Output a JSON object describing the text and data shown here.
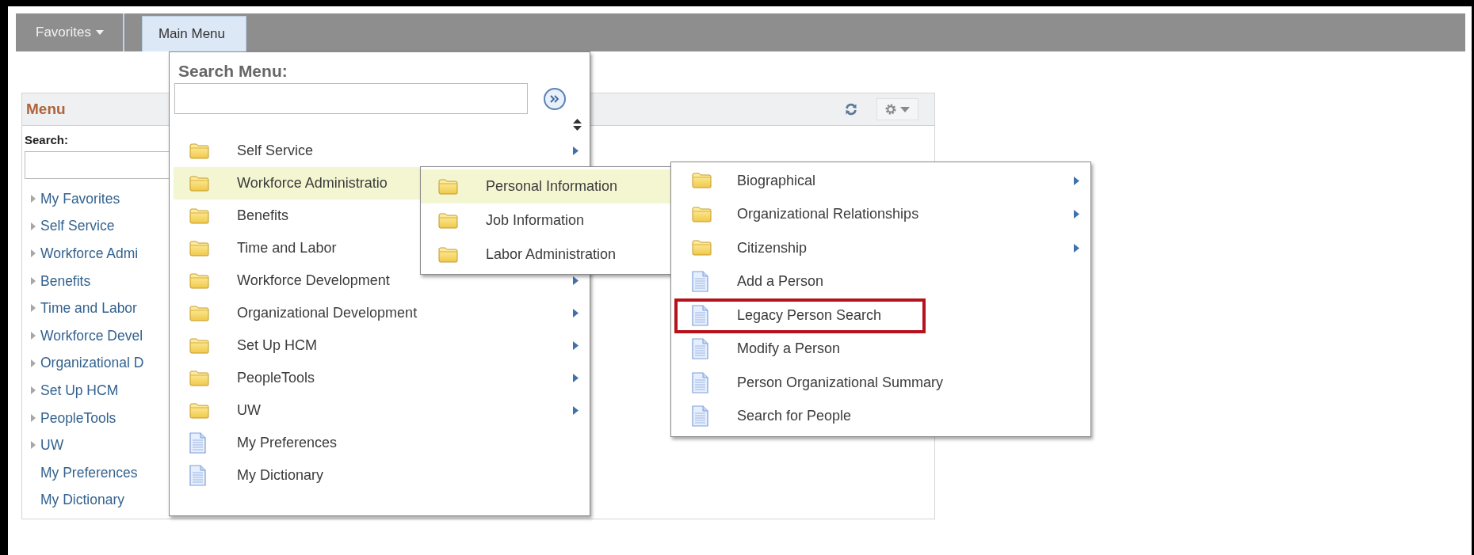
{
  "nav": {
    "tabs": [
      {
        "label": "Favorites",
        "selected": false
      },
      {
        "label": "Main Menu",
        "selected": true
      }
    ]
  },
  "pagelet": {
    "title": "Menu",
    "search_label": "Search:",
    "items": [
      {
        "label": "My Favorites",
        "kind": "folder"
      },
      {
        "label": "Self Service",
        "kind": "folder"
      },
      {
        "label": "Workforce Admi",
        "kind": "folder"
      },
      {
        "label": "Benefits",
        "kind": "folder"
      },
      {
        "label": "Time and Labor",
        "kind": "folder"
      },
      {
        "label": "Workforce Devel",
        "kind": "folder"
      },
      {
        "label": "Organizational D",
        "kind": "folder"
      },
      {
        "label": "Set Up HCM",
        "kind": "folder"
      },
      {
        "label": "PeopleTools",
        "kind": "folder"
      },
      {
        "label": "UW",
        "kind": "folder"
      },
      {
        "label": "My Preferences",
        "kind": "page"
      },
      {
        "label": "My Dictionary",
        "kind": "page"
      }
    ]
  },
  "main_menu": {
    "search_label": "Search Menu:",
    "items": [
      {
        "label": "Self Service",
        "kind": "folder",
        "arrow": true,
        "selected": false
      },
      {
        "label": "Workforce Administratio",
        "kind": "folder",
        "selected": true
      },
      {
        "label": "Benefits",
        "kind": "folder",
        "selected": false
      },
      {
        "label": "Time and Labor",
        "kind": "folder",
        "selected": false
      },
      {
        "label": "Workforce Development",
        "kind": "folder",
        "arrow": true,
        "selected": false
      },
      {
        "label": "Organizational Development",
        "kind": "folder",
        "arrow": true,
        "selected": false
      },
      {
        "label": "Set Up HCM",
        "kind": "folder",
        "arrow": true,
        "selected": false
      },
      {
        "label": "PeopleTools",
        "kind": "folder",
        "arrow": true,
        "selected": false
      },
      {
        "label": "UW",
        "kind": "folder",
        "arrow": true,
        "selected": false
      },
      {
        "label": "My Preferences",
        "kind": "page",
        "arrow": false,
        "selected": false
      },
      {
        "label": "My Dictionary",
        "kind": "page",
        "arrow": false,
        "selected": false
      }
    ]
  },
  "submenu": {
    "items": [
      {
        "label": "Personal Information",
        "kind": "folder",
        "selected": true
      },
      {
        "label": "Job Information",
        "kind": "folder",
        "selected": false
      },
      {
        "label": "Labor Administration",
        "kind": "folder",
        "selected": false
      }
    ]
  },
  "submenu_2": {
    "items": [
      {
        "label": "Biographical",
        "kind": "folder",
        "arrow": true,
        "highlighted": false
      },
      {
        "label": "Organizational Relationships",
        "kind": "folder",
        "arrow": true,
        "highlighted": false
      },
      {
        "label": "Citizenship",
        "kind": "folder",
        "arrow": true,
        "highlighted": false
      },
      {
        "label": "Add a Person",
        "kind": "page",
        "arrow": false,
        "highlighted": false
      },
      {
        "label": "Legacy Person Search",
        "kind": "page",
        "arrow": false,
        "highlighted": true
      },
      {
        "label": "Modify a Person",
        "kind": "page",
        "arrow": false,
        "highlighted": false
      },
      {
        "label": "Person Organizational Summary",
        "kind": "page",
        "arrow": false,
        "highlighted": false
      },
      {
        "label": "Search for People",
        "kind": "page",
        "arrow": false,
        "highlighted": false
      }
    ]
  }
}
